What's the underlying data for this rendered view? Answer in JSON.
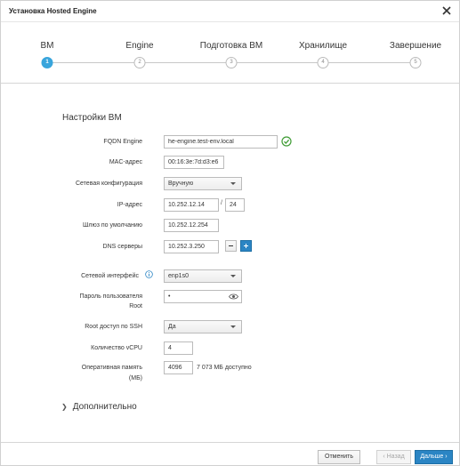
{
  "dialog": {
    "title": "Установка Hosted Engine"
  },
  "wizard": {
    "steps": [
      {
        "label": "ВМ",
        "number": "1",
        "active": true
      },
      {
        "label": "Engine",
        "number": "2",
        "active": false
      },
      {
        "label": "Подготовка ВМ",
        "number": "3",
        "active": false
      },
      {
        "label": "Хранилище",
        "number": "4",
        "active": false
      },
      {
        "label": "Завершение",
        "number": "5",
        "active": false
      }
    ]
  },
  "section": {
    "title": "Настройки ВМ"
  },
  "form": {
    "fqdn": {
      "label": "FQDN Engine",
      "value": "he-engine.test-env.local"
    },
    "mac": {
      "label": "MAC-адрес",
      "value": "00:16:3e:7d:d3:e6"
    },
    "netconfig": {
      "label": "Сетевая конфигурация",
      "value": "Вручную"
    },
    "ip": {
      "label": "IP-адрес",
      "value": "10.252.12.14",
      "prefix": "24",
      "separator": "/"
    },
    "gateway": {
      "label": "Шлюз по умолчанию",
      "value": "10.252.12.254"
    },
    "dns": {
      "label": "DNS серверы",
      "value": "10.252.3.250"
    },
    "nic": {
      "label": "Сетевой интерфейс",
      "value": "enp1s0"
    },
    "root_password": {
      "label_line1": "Пароль пользователя",
      "label_line2": "Root",
      "value": "•"
    },
    "ssh": {
      "label": "Root доступ по SSH",
      "value": "Да"
    },
    "vcpu": {
      "label": "Количество vCPU",
      "value": "4"
    },
    "memory": {
      "label_line1": "Оперативная память",
      "label_line2": "(МБ)",
      "value": "4096",
      "available": "7 073 МБ доступно"
    }
  },
  "advanced": {
    "label": "Дополнительно"
  },
  "footer": {
    "cancel": "Отменить",
    "back": "‹ Назад",
    "next": "Дальше ›"
  },
  "colors": {
    "accent": "#39a5dc",
    "primary_button": "#2b85c4",
    "success": "#3f9c35"
  },
  "icons": {
    "close": "close-icon",
    "check": "check-circle-icon",
    "info": "info-icon",
    "eye": "eye-icon",
    "chevron": "chevron-right-icon"
  }
}
